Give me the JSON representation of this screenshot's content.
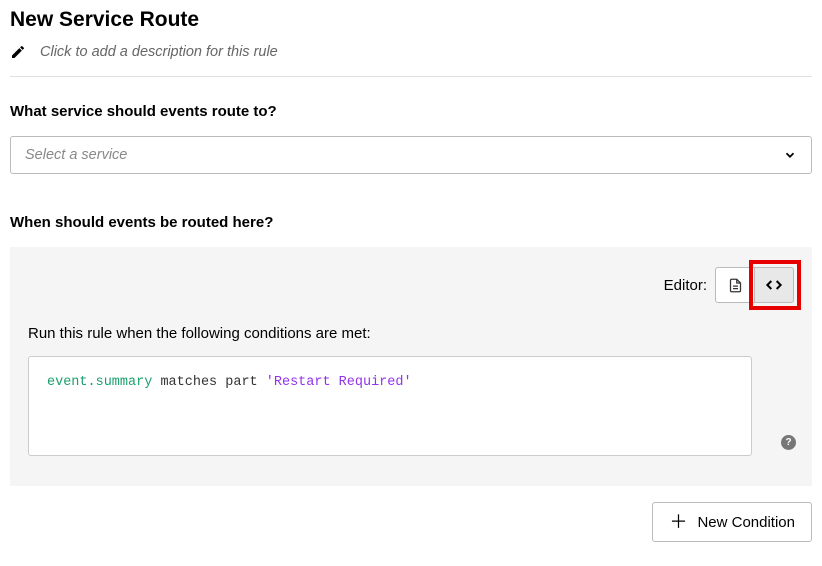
{
  "header": {
    "title": "New Service Route",
    "description_placeholder": "Click to add a description for this rule"
  },
  "service_section": {
    "label": "What service should events route to?",
    "select_placeholder": "Select a service"
  },
  "conditions_section": {
    "label": "When should events be routed here?",
    "editor_label": "Editor:",
    "rule_intro": "Run this rule when the following conditions are met:",
    "code": {
      "path": "event.summary",
      "operator": "matches part",
      "value": "'Restart Required'"
    },
    "help_tooltip": "?"
  },
  "footer": {
    "new_condition_label": "New Condition"
  }
}
